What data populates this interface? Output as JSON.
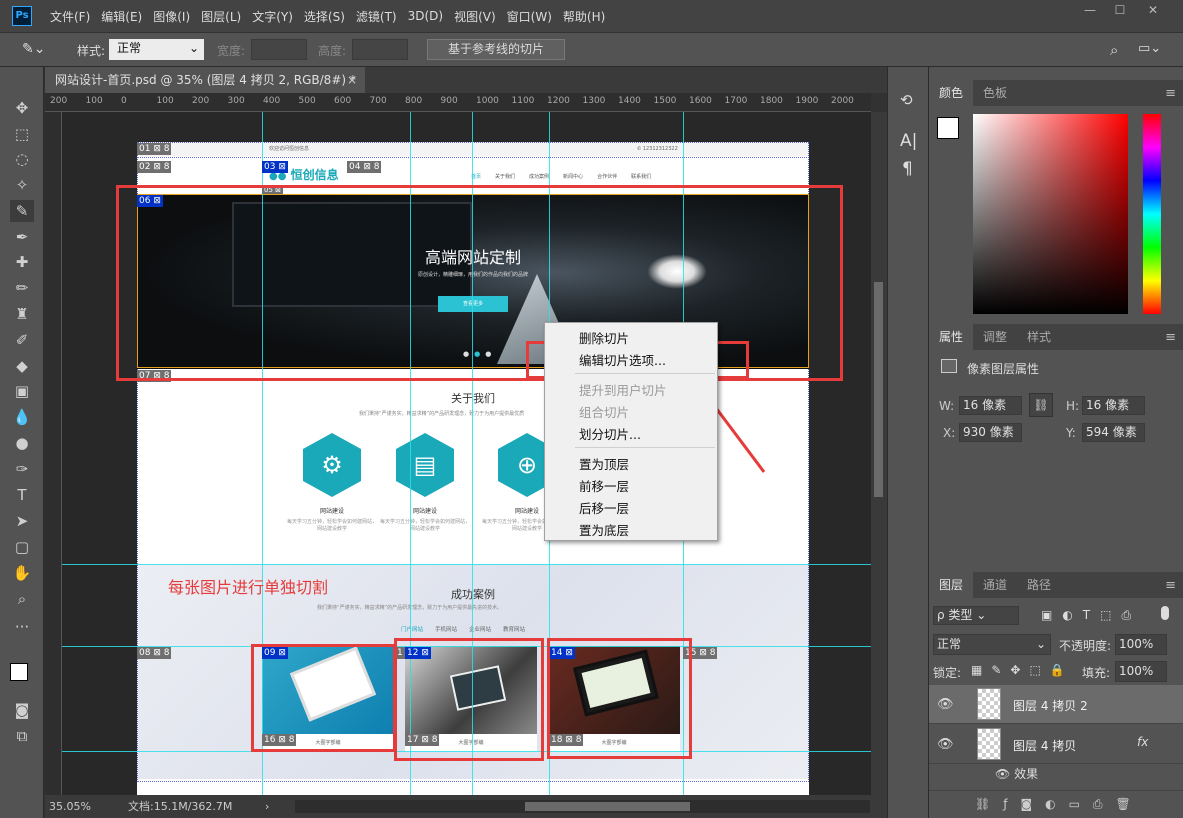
{
  "menubar": {
    "logo": "Ps",
    "items": [
      "文件(F)",
      "编辑(E)",
      "图像(I)",
      "图层(L)",
      "文字(Y)",
      "选择(S)",
      "滤镜(T)",
      "3D(D)",
      "视图(V)",
      "窗口(W)",
      "帮助(H)"
    ],
    "window_controls": [
      "—",
      "☐",
      "✕"
    ]
  },
  "options": {
    "style_label": "样式:",
    "style_value": "正常",
    "width_label": "宽度:",
    "height_label": "高度:",
    "guide_button": "基于参考线的切片"
  },
  "tab": {
    "title": "网站设计-首页.psd @ 35% (图层 4 拷贝 2, RGB/8#) *",
    "close": "×"
  },
  "ruler": {
    "ticks": [
      "200",
      "100",
      "0",
      "100",
      "200",
      "300",
      "400",
      "500",
      "600",
      "700",
      "800",
      "900",
      "1000",
      "1100",
      "1200",
      "1300",
      "1400",
      "1500",
      "1600",
      "1700",
      "1800",
      "1900",
      "2000"
    ]
  },
  "status": {
    "zoom": "35.05%",
    "doc": "文档:15.1M/362.7M",
    "arrow": "›"
  },
  "site": {
    "topbar_text": "欢迎访问恒创信息",
    "phone": "✆ 12312312322",
    "logo_text": "恒创信息",
    "nav": [
      "首页",
      "关于我们",
      "成功案例",
      "新闻中心",
      "合作伙伴",
      "联系我们"
    ],
    "hero_title": "高端网站定制",
    "hero_sub": "原创设计，精雕细琢，用我们的作品向我们的品牌",
    "hero_btn": "查看更多",
    "about_title": "关于我们",
    "about_sub": "我们秉持“严谨务实，精益求精”的产品研发理念，致力于为用户提供最优质",
    "services": [
      {
        "title": "网站建设",
        "desc": "每天学习五分钟，轻松学会如何建网站，网站建设教学"
      },
      {
        "title": "网站建设",
        "desc": "每天学习五分钟，轻松学会如何建网站，网站建设教学"
      },
      {
        "title": "网站建设",
        "desc": "每天学习五分钟，轻松学会如何建网站，网站建设教学"
      }
    ],
    "cases_title": "成功案例",
    "cases_sub": "我们秉持“严谨务实，精益求精”的产品研发理念，致力于为用户提供最先进的技术。",
    "case_tabs": [
      "门户网站",
      "手机网站",
      "企业网站",
      "教育网站"
    ],
    "case_captions": [
      "大图字部编",
      "大图字部编",
      "大图字部编"
    ]
  },
  "slices": [
    "01",
    "02",
    "03",
    "04",
    "05",
    "06",
    "07",
    "08",
    "09",
    "12",
    "14",
    "15",
    "16",
    "17",
    "18",
    "1"
  ],
  "annotation": "每张图片进行单独切割",
  "context_menu": {
    "items": [
      {
        "label": "删除切片",
        "disabled": false
      },
      {
        "label": "编辑切片选项...",
        "disabled": false
      },
      {
        "label": "提升到用户切片",
        "disabled": true
      },
      {
        "label": "组合切片",
        "disabled": true
      },
      {
        "label": "划分切片...",
        "disabled": false
      },
      {
        "label": "置为顶层",
        "disabled": false
      },
      {
        "label": "前移一层",
        "disabled": false
      },
      {
        "label": "后移一层",
        "disabled": false
      },
      {
        "label": "置为底层",
        "disabled": false
      }
    ]
  },
  "color_panel": {
    "tabs": [
      "颜色",
      "色板"
    ]
  },
  "props_panel": {
    "tabs": [
      "属性",
      "调整",
      "样式"
    ],
    "title": "像素图层属性",
    "w_label": "W:",
    "w_value": "16 像素",
    "h_label": "H:",
    "h_value": "16 像素",
    "x_label": "X:",
    "x_value": "930 像素",
    "y_label": "Y:",
    "y_value": "594 像素"
  },
  "layers_panel": {
    "tabs": [
      "图层",
      "通道",
      "路径"
    ],
    "filter_kind": "ρ 类型",
    "blend": "正常",
    "opacity_label": "不透明度:",
    "opacity": "100%",
    "lock_label": "锁定:",
    "fill_label": "填充:",
    "fill": "100%",
    "layers": [
      {
        "name": "图层 4 拷贝 2"
      },
      {
        "name": "图层 4 拷贝",
        "fx": "fx"
      }
    ],
    "effect": "效果"
  },
  "colors": {
    "accent": "#1aa9b8",
    "slice_blue": "#0032c8",
    "guide": "#29e0ea",
    "highlight": "#e63b3b"
  }
}
